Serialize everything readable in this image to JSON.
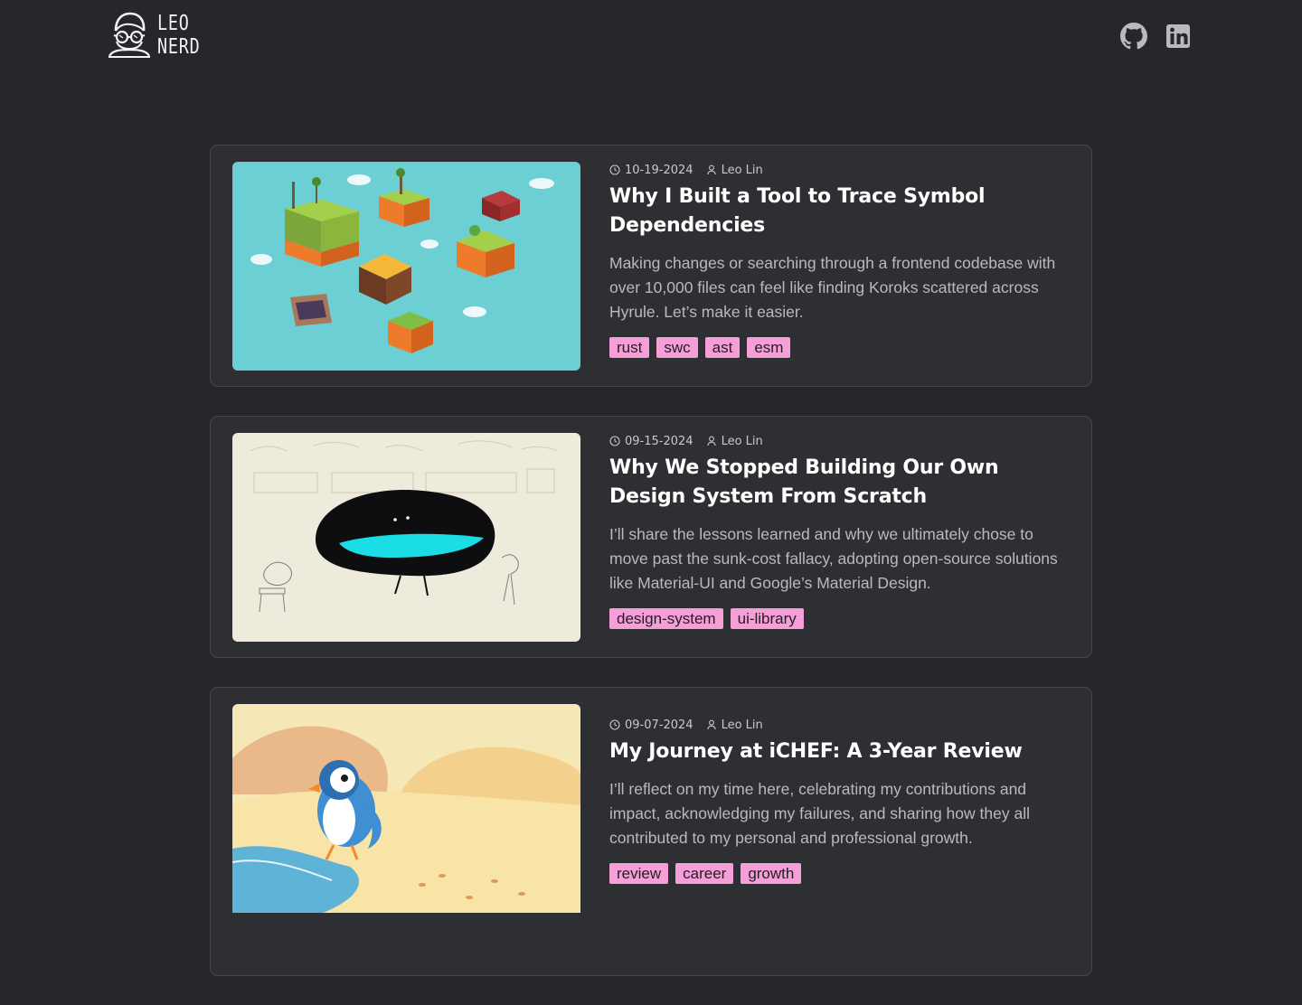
{
  "header": {
    "logo_line1": "LEO",
    "logo_line2": "NERD",
    "social": [
      {
        "icon": "github-icon",
        "label": "GitHub"
      },
      {
        "icon": "linkedin-icon",
        "label": "LinkedIn"
      }
    ]
  },
  "colors": {
    "background": "#26272b",
    "card": "#2e2f33",
    "card_border": "#46474c",
    "tag_bg": "#f59ed7",
    "tag_text": "#1f1f22"
  },
  "posts": [
    {
      "date": "10-19-2024",
      "author": "Leo Lin",
      "title": "Why I Built a Tool to Trace Symbol Dependencies",
      "description": "Making changes or searching through a frontend codebase with over 10,000 files can feel like finding Koroks scattered across Hyrule. Let’s make it easier.",
      "tags": [
        "rust",
        "swc",
        "ast",
        "esm"
      ]
    },
    {
      "date": "09-15-2024",
      "author": "Leo Lin",
      "title": "Why We Stopped Building Our Own Design System From Scratch",
      "description": "I’ll share the lessons learned and why we ultimately chose to move past the sunk-cost fallacy, adopting open-source solutions like Material-UI and Google’s Material Design.",
      "tags": [
        "design-system",
        "ui-library"
      ]
    },
    {
      "date": "09-07-2024",
      "author": "Leo Lin",
      "title": "My Journey at iCHEF: A 3-Year Review",
      "description": "I’ll reflect on my time here, celebrating my contributions and impact, acknowledging my failures, and sharing how they all contributed to my personal and professional growth.",
      "tags": [
        "review",
        "career",
        "growth"
      ]
    }
  ]
}
